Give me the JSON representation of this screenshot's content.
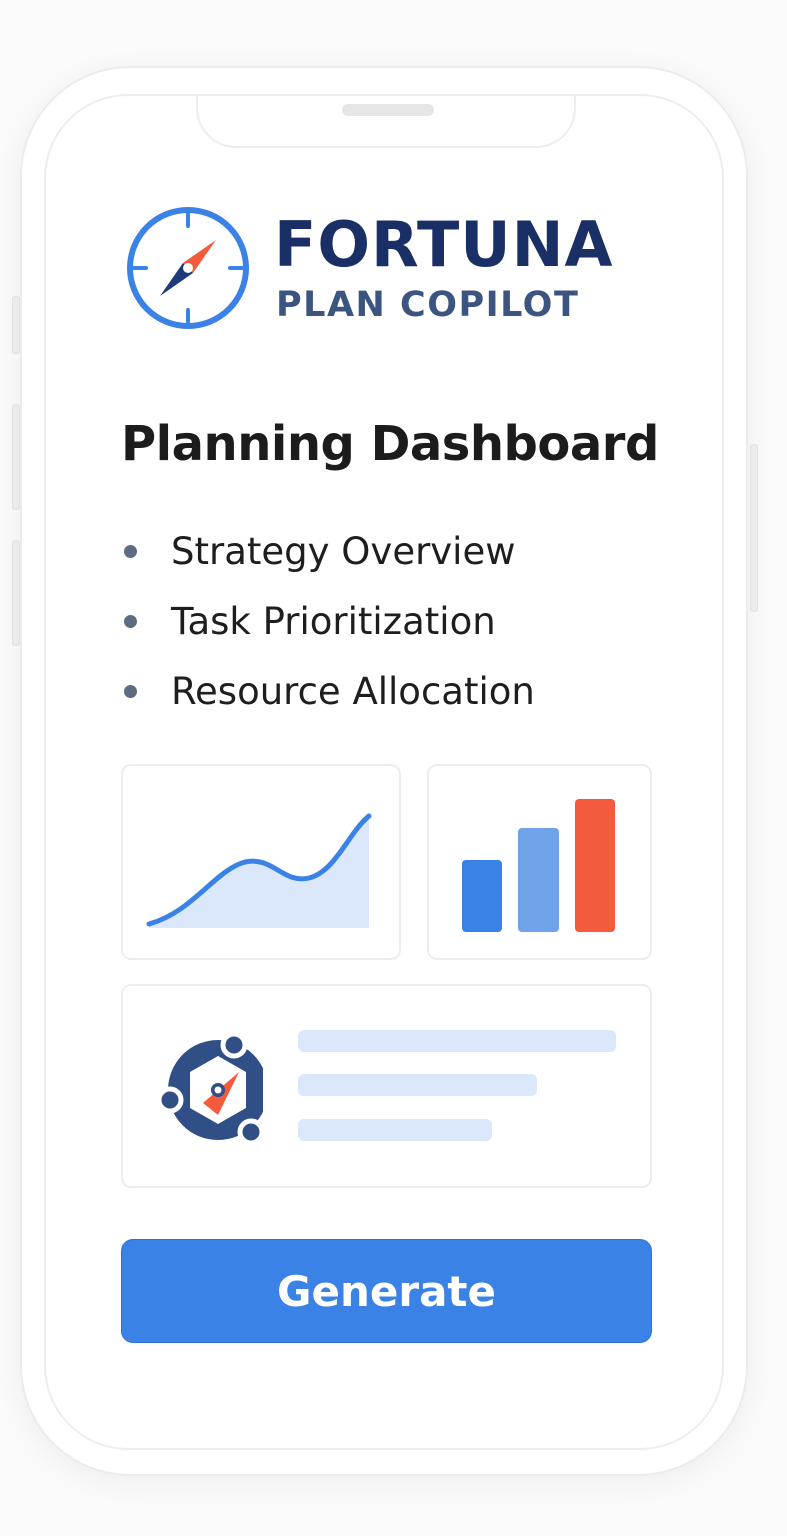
{
  "brand": {
    "name": "FORTUNA",
    "subtitle": "PLAN COPILOT",
    "logo_icon": "compass-icon"
  },
  "page": {
    "title": "Planning Dashboard"
  },
  "menu": {
    "items": [
      {
        "label": "Strategy Overview"
      },
      {
        "label": "Task Prioritization"
      },
      {
        "label": "Resource Allocation"
      }
    ]
  },
  "widgets": {
    "trend_chart_icon": "area-line-chart-icon",
    "bar_chart_icon": "bar-chart-icon",
    "copilot_icon": "copilot-hub-icon"
  },
  "colors": {
    "brand_navy": "#1a2f66",
    "accent_blue": "#3b82e6",
    "accent_red": "#f45b3c",
    "light_blue": "#dbe7fb"
  },
  "actions": {
    "generate_label": "Generate"
  }
}
